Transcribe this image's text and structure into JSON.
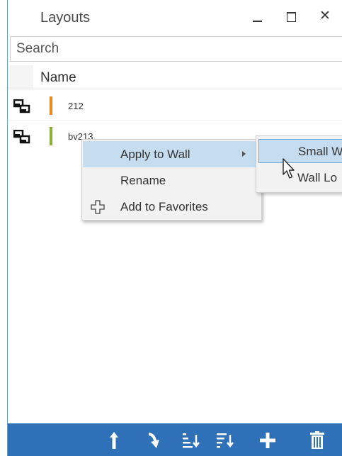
{
  "window": {
    "title": "Layouts",
    "close_symbol": "✕"
  },
  "search": {
    "placeholder": "Search",
    "value": ""
  },
  "list": {
    "column_name": "Name",
    "rows": [
      {
        "name": "212",
        "color": "#f0891e",
        "icon": "layout-icon"
      },
      {
        "name": "bv213",
        "color": "#8fae3b",
        "icon": "layout-icon"
      }
    ]
  },
  "context_menu": {
    "items": [
      {
        "label": "Apply to Wall",
        "has_submenu": true,
        "highlighted": true
      },
      {
        "label": "Rename"
      },
      {
        "label": "Add to Favorites",
        "icon": "plus-outline-icon"
      }
    ]
  },
  "submenu": {
    "items": [
      {
        "label": "Small W",
        "highlighted": true
      },
      {
        "label": "Wall Lo"
      }
    ]
  },
  "toolbar": {
    "buttons": [
      {
        "name": "move-up-icon"
      },
      {
        "name": "move-down-icon"
      },
      {
        "name": "sort-ascending-icon"
      },
      {
        "name": "sort-descending-icon"
      },
      {
        "name": "add-icon"
      },
      {
        "name": "delete-icon"
      }
    ]
  },
  "colors": {
    "toolbar_bg": "#2e71b8",
    "menu_highlight": "#c6dcef",
    "menu_highlight_border": "#69a7d8"
  }
}
